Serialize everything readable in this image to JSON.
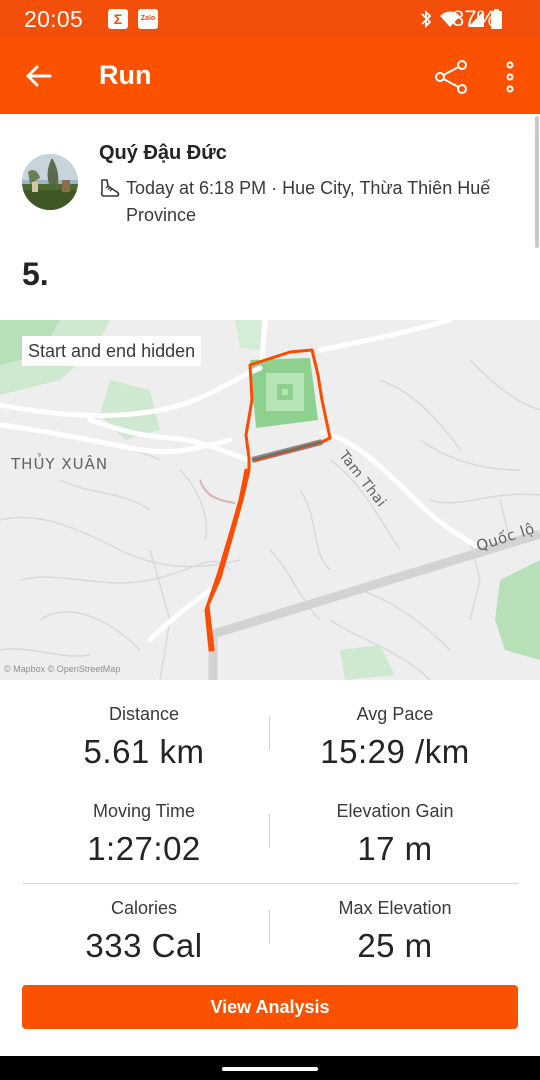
{
  "status_bar": {
    "time": "20:05",
    "notif_sigma": "Σ",
    "notif_zalo": "Zalo",
    "battery": "87%",
    "icons": [
      "bluetooth-icon",
      "wifi-icon",
      "signal-icon",
      "battery-icon"
    ]
  },
  "app_bar": {
    "title": "Run",
    "back_icon": "arrow-left-icon",
    "share_icon": "share-icon",
    "more_icon": "more-vertical-icon"
  },
  "activity": {
    "athlete_name": "Quý Đậu Đức",
    "meta": "Today at 6:18 PM · Hue City, Thừa Thiên Huế Province",
    "title": "5."
  },
  "map": {
    "privacy_badge": "Start and end hidden",
    "labels": {
      "area": "THỦY XUÂN",
      "street": "Tam Thai",
      "highway": "Quốc lộ"
    },
    "attribution": "© Mapbox © OpenStreetMap",
    "route_color": "#fc4c02"
  },
  "stats": {
    "distance": {
      "label": "Distance",
      "value": "5.61 km"
    },
    "avg_pace": {
      "label": "Avg Pace",
      "value": "15:29 /km"
    },
    "moving_time": {
      "label": "Moving Time",
      "value": "1:27:02"
    },
    "elevation_gain": {
      "label": "Elevation Gain",
      "value": "17 m"
    },
    "calories": {
      "label": "Calories",
      "value": "333 Cal"
    },
    "max_elevation": {
      "label": "Max Elevation",
      "value": "25 m"
    }
  },
  "actions": {
    "view_analysis": "View Analysis"
  },
  "colors": {
    "brand": "#fc5200",
    "status_bar": "#f34e0a"
  }
}
